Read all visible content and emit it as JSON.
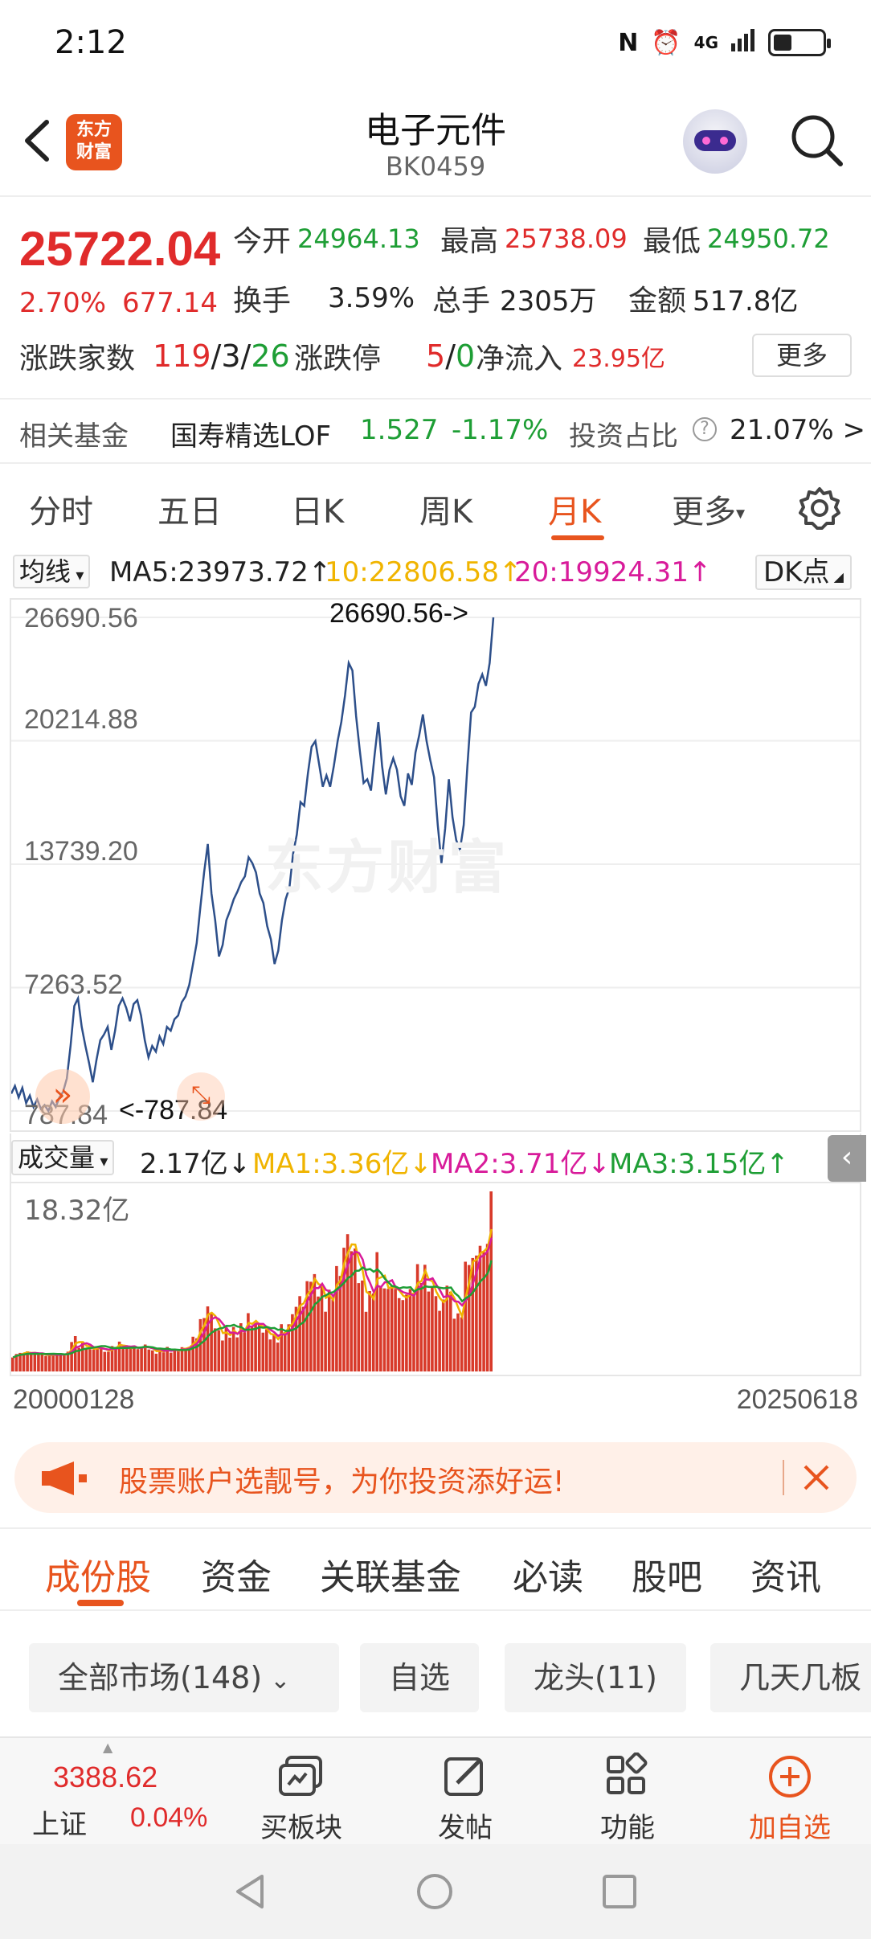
{
  "status_bar": {
    "time": "2:12",
    "network": "4G"
  },
  "header": {
    "title": "电子元件",
    "code": "BK0459",
    "logo_text": "东方财富"
  },
  "quote": {
    "price": "25722.04",
    "change_pct": "2.70%",
    "change_amt": "677.14",
    "open_label": "今开",
    "open": "24964.13",
    "high_label": "最高",
    "high": "25738.09",
    "low_label": "最低",
    "low": "24950.72",
    "turnover_label": "换手",
    "turnover": "3.59%",
    "volume_label": "总手",
    "volume": "2305万",
    "amount_label": "金额",
    "amount": "517.8亿",
    "breadth_label": "涨跌家数",
    "up_count": "119",
    "flat_count": "3",
    "down_count": "26",
    "limit_label": "涨跌停",
    "limit_up": "5",
    "limit_down": "0",
    "inflow_label": "净流入",
    "inflow": "23.95亿",
    "more_label": "更多"
  },
  "fund": {
    "label": "相关基金",
    "name": "国寿精选LOF",
    "price": "1.527",
    "change": "-1.17%",
    "ratio_label": "投资占比",
    "ratio": "21.07% >"
  },
  "chart_tabs": [
    "分时",
    "五日",
    "日K",
    "周K",
    "月K",
    "更多"
  ],
  "active_chart_tab": "月K",
  "ma": {
    "selector": "均线",
    "ma5": "MA5:23973.72↑",
    "ma10": "10:22806.58↑",
    "ma20": "20:19924.31↑",
    "dk_label": "DK点",
    "colors": {
      "ma5": "#222222",
      "ma10": "#f0b400",
      "ma20": "#d81b9a"
    }
  },
  "price_axis": [
    "26690.56",
    "20214.88",
    "13739.20",
    "7263.52",
    "787.84"
  ],
  "max_marker": "26690.56->",
  "min_marker": "<-787.84",
  "watermark": "东方财富",
  "volume": {
    "selector": "成交量",
    "current": "2.17亿↓",
    "ma1": "MA1:3.36亿↓",
    "ma2": "MA2:3.71亿↓",
    "ma3": "MA3:3.15亿↑",
    "max_label": "18.32亿",
    "colors": {
      "bar": "#d83a2a",
      "ma1": "#f0b400",
      "ma2": "#d81b9a",
      "ma3": "#1e9e35"
    }
  },
  "dates": {
    "start": "20000128",
    "end": "20250618"
  },
  "chart_data": {
    "type": "line",
    "title": "",
    "x_range": [
      "20000128",
      "20250618"
    ],
    "ylim": [
      787.84,
      26690.56
    ],
    "series": [
      {
        "values": [
          1700,
          2100,
          1500,
          2000,
          1200,
          1600,
          1000,
          1400,
          900,
          1100,
          787.84,
          1300,
          1000,
          1500,
          1800,
          2500,
          4200,
          6300,
          6700,
          5200,
          4200,
          3300,
          2300,
          3500,
          4500,
          4800,
          5200,
          4000,
          5000,
          6300,
          6700,
          6200,
          5500,
          6400,
          6600,
          5800,
          4500,
          3600,
          4200,
          3900,
          4700,
          4300,
          5200,
          5000,
          5600,
          5800,
          6500,
          6800,
          7400,
          8500,
          9600,
          11500,
          13300,
          14800,
          12200,
          10800,
          8900,
          9500,
          10800,
          11300,
          11900,
          12300,
          12800,
          13100,
          14100,
          13800,
          13300,
          12200,
          11700,
          10500,
          9800,
          8500,
          9200,
          10800,
          11900,
          12500,
          14300,
          15300,
          17000,
          16800,
          18500,
          19900,
          20200,
          19000,
          17800,
          18400,
          17800,
          18900,
          20200,
          21200,
          22600,
          24300,
          23900,
          21500,
          19700,
          18000,
          18200,
          17600,
          19500,
          21200,
          18900,
          17400,
          18700,
          19300,
          18700,
          17300,
          16800,
          18500,
          17900,
          19600,
          20500,
          21600,
          20200,
          19200,
          18300,
          15800,
          13800,
          15600,
          18200,
          16200,
          15000,
          14500,
          15800,
          18900,
          21700,
          22000,
          23200,
          23700,
          23100,
          24300,
          26690.56
        ]
      }
    ]
  },
  "banner": {
    "text": "股票账户选靓号，为你投资添好运!"
  },
  "content_tabs": [
    "成份股",
    "资金",
    "关联基金",
    "必读",
    "股吧",
    "资讯"
  ],
  "active_content_tab": "成份股",
  "filters": [
    "全部市场(148)",
    "自选",
    "龙头(11)",
    "几天几板"
  ],
  "toolbar": {
    "index_value": "3388.62",
    "index_name": "上证",
    "index_change": "0.04%",
    "items": [
      "买板块",
      "发帖",
      "功能",
      "加自选"
    ]
  }
}
